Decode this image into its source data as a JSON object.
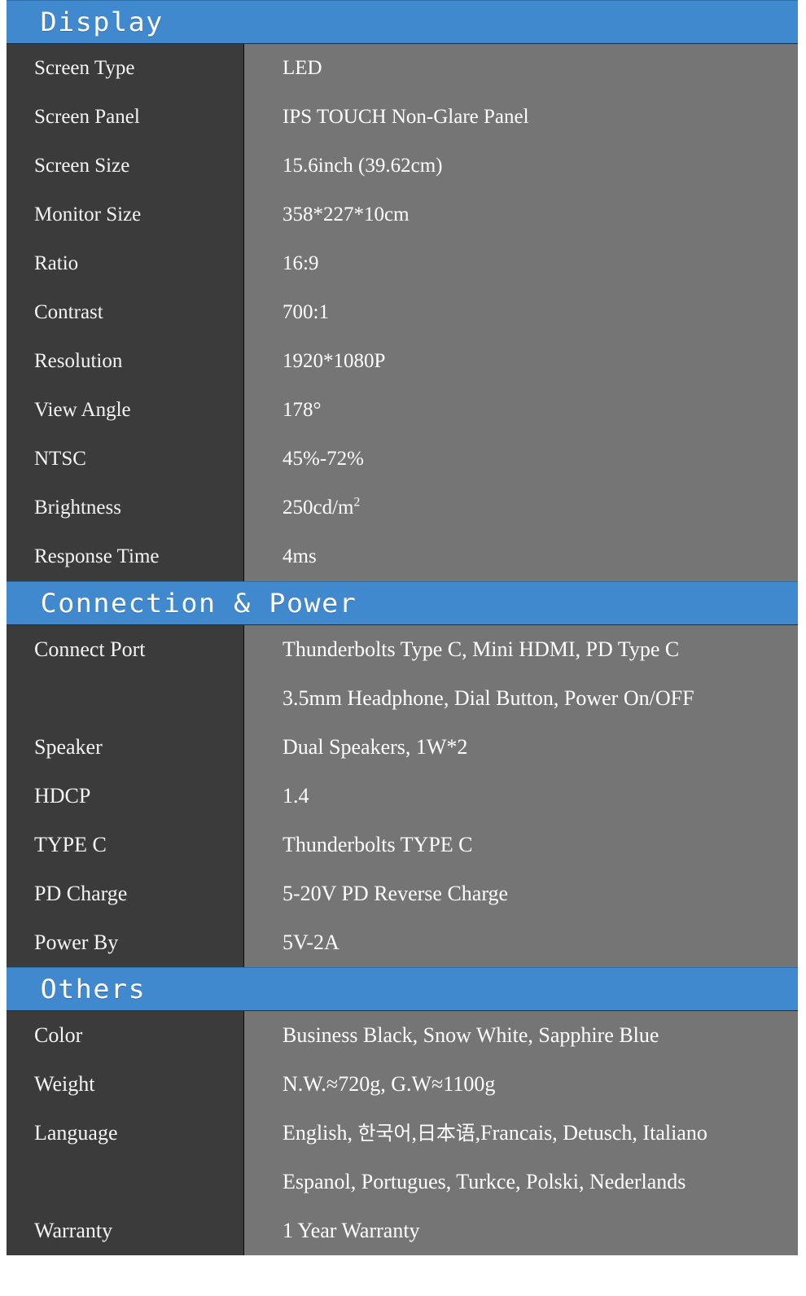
{
  "theme": {
    "accent": "#4189ce",
    "label_column_bg": "#3b3b3b",
    "value_column_bg": "#757575",
    "text_color": "#ffffff"
  },
  "sections": [
    {
      "title": "Display",
      "rows": [
        {
          "label": "Screen Type",
          "value": "LED"
        },
        {
          "label": "Screen Panel",
          "value": "IPS TOUCH Non-Glare Panel"
        },
        {
          "label": "Screen Size",
          "value": "15.6inch (39.62cm)"
        },
        {
          "label": "Monitor Size",
          "value": "358*227*10cm"
        },
        {
          "label": "Ratio",
          "value": "16:9"
        },
        {
          "label": "Contrast",
          "value": "700:1"
        },
        {
          "label": "Resolution",
          "value": "1920*1080P"
        },
        {
          "label": "View Angle",
          "value": "178°"
        },
        {
          "label": "NTSC",
          "value": "45%-72%"
        },
        {
          "label": "Brightness",
          "value": "250cd/m2",
          "value_html": "250cd/m<sup>2</sup>"
        },
        {
          "label": "Response Time",
          "value": "4ms"
        }
      ]
    },
    {
      "title": "Connection & Power",
      "rows": [
        {
          "label": "Connect Port",
          "value": "Thunderbolts Type C, Mini HDMI, PD Type C"
        },
        {
          "label": "",
          "value": "3.5mm Headphone, Dial Button, Power On/OFF"
        },
        {
          "label": "Speaker",
          "value": "Dual Speakers, 1W*2"
        },
        {
          "label": "HDCP",
          "value": "1.4"
        },
        {
          "label": "TYPE C",
          "value": "Thunderbolts TYPE C"
        },
        {
          "label": "PD Charge",
          "value": "5-20V PD Reverse Charge"
        },
        {
          "label": "Power By",
          "value": "5V-2A"
        }
      ]
    },
    {
      "title": "Others",
      "rows": [
        {
          "label": "Color",
          "value": "Business Black, Snow White, Sapphire Blue"
        },
        {
          "label": "Weight",
          "value": "N.W.≈720g,   G.W≈1100g"
        },
        {
          "label": "Language",
          "value": "English, 한국어,日本语,Francais, Detusch, Italiano",
          "value_html": "English, <span class=\"cjk\">한국어</span>,<span class=\"cjk\">日本语</span>,Francais, Detusch, Italiano"
        },
        {
          "label": "",
          "value": "Espanol, Portugues, Turkce, Polski, Nederlands"
        },
        {
          "label": "Warranty",
          "value": "1 Year Warranty"
        }
      ]
    }
  ]
}
